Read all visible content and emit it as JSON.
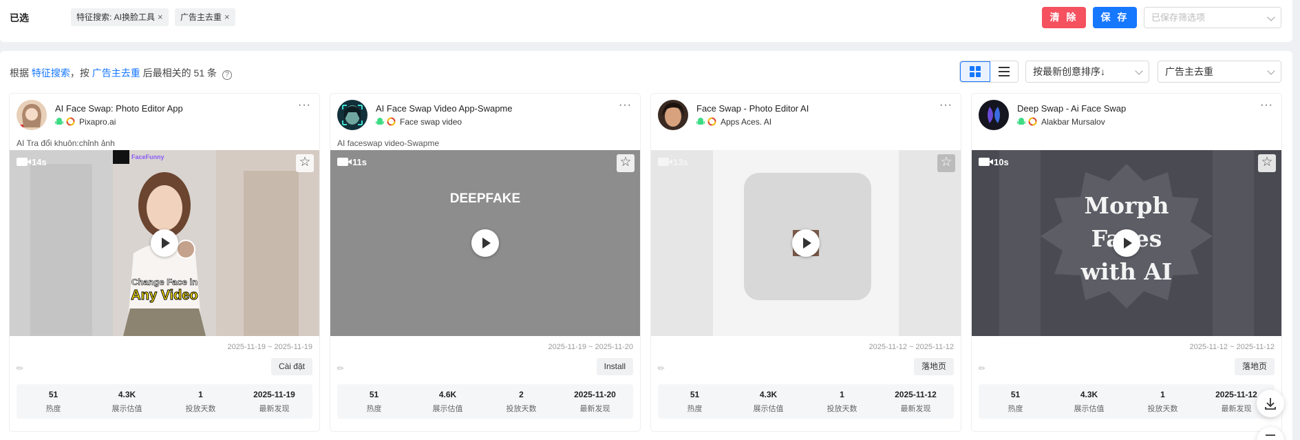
{
  "filter_bar": {
    "label": "已选",
    "chips": [
      {
        "text": "特征搜索: AI换脸工具"
      },
      {
        "text": "广告主去重"
      }
    ],
    "clear_label": "清 除",
    "save_label": "保 存",
    "saved_placeholder": "已保存筛选项"
  },
  "results": {
    "summary_prefix": "根据",
    "summary_search": "特征搜索",
    "summary_mid": "，按",
    "summary_dedupe": "广告主去重",
    "summary_suffix": "后最相关的 51 条",
    "help_glyph": "?",
    "sort_label": "按最新创意排序↓",
    "dedupe_label": "广告主去重"
  },
  "cards": [
    {
      "app_name": "AI Face Swap: Photo Editor App",
      "advertiser": "Pixapro.ai",
      "ad_title": "AI Tra đổi khuôn:chỉnh ảnh",
      "duration": "14s",
      "date_range": "2025-11-19 ~ 2025-11-19",
      "cta": "Cài đặt",
      "more": "···",
      "stats": [
        {
          "value": "51",
          "label": "热度"
        },
        {
          "value": "4.3K",
          "label": "展示估值"
        },
        {
          "value": "1",
          "label": "投放天数"
        },
        {
          "value": "2025-11-19",
          "label": "最新发现"
        }
      ],
      "media_text_1": "Change Face in",
      "media_text_2": "Any Video",
      "media_brand": "FaceFunny"
    },
    {
      "app_name": "AI Face Swap Video App-Swapme",
      "advertiser": "Face swap video",
      "ad_title": "AI faceswap video-Swapme",
      "duration": "11s",
      "date_range": "2025-11-19 ~ 2025-11-20",
      "cta": "Install",
      "more": "···",
      "stats": [
        {
          "value": "51",
          "label": "热度"
        },
        {
          "value": "4.6K",
          "label": "展示估值"
        },
        {
          "value": "2",
          "label": "投放天数"
        },
        {
          "value": "2025-11-20",
          "label": "最新发现"
        }
      ],
      "media_text_1": "DEEPFAKE"
    },
    {
      "app_name": "Face Swap - Photo Editor AI",
      "advertiser": "Apps Aces. AI",
      "ad_title": "",
      "duration": "13s",
      "date_range": "2025-11-12 ~ 2025-11-12",
      "cta": "落地页",
      "more": "···",
      "stats": [
        {
          "value": "51",
          "label": "热度"
        },
        {
          "value": "4.3K",
          "label": "展示估值"
        },
        {
          "value": "1",
          "label": "投放天数"
        },
        {
          "value": "2025-11-12",
          "label": "最新发现"
        }
      ]
    },
    {
      "app_name": "Deep Swap - Ai Face Swap",
      "advertiser": "Alakbar Mursalov",
      "ad_title": "",
      "duration": "10s",
      "date_range": "2025-11-12 ~ 2025-11-12",
      "cta": "落地页",
      "more": "···",
      "stats": [
        {
          "value": "51",
          "label": "热度"
        },
        {
          "value": "4.3K",
          "label": "展示估值"
        },
        {
          "value": "1",
          "label": "投放天数"
        },
        {
          "value": "2025-11-12",
          "label": "最新发现"
        }
      ],
      "media_text_1": "Morph",
      "media_text_2": "Faces",
      "media_text_3": "with AI"
    }
  ],
  "colors": {
    "primary": "#1677ff",
    "danger": "#f5515f",
    "android": "#3ddc84"
  }
}
